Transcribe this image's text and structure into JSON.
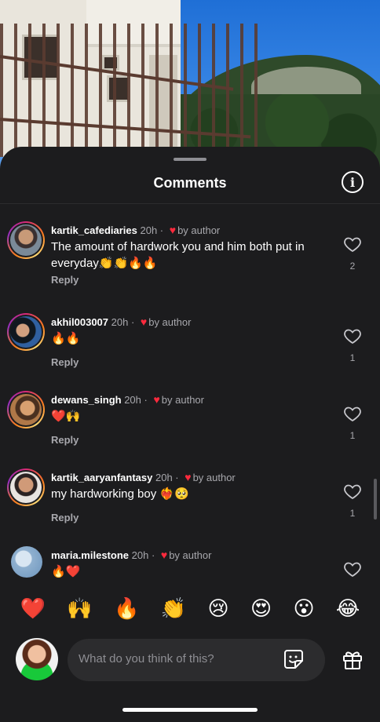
{
  "sheet": {
    "title": "Comments"
  },
  "comments": [
    {
      "username": "kartik_cafediaries",
      "time": "20h",
      "liked_by": "by author",
      "text": "The amount of hardwork you and him both put in everyday👏👏🔥🔥",
      "reply": "Reply",
      "likes": "2"
    },
    {
      "username": "akhil003007",
      "time": "20h",
      "liked_by": "by author",
      "text": "🔥🔥",
      "reply": "Reply",
      "likes": "1"
    },
    {
      "username": "dewans_singh",
      "time": "20h",
      "liked_by": "by author",
      "text": "❤️🙌",
      "reply": "Reply",
      "likes": "1"
    },
    {
      "username": "kartik_aaryanfantasy",
      "time": "20h",
      "liked_by": "by author",
      "text": "my hardworking boy ❤️‍🔥🥺",
      "reply": "Reply",
      "likes": "1"
    },
    {
      "username": "maria.milestone",
      "time": "20h",
      "liked_by": "by author",
      "text": "🔥❤️"
    }
  ],
  "quick_reactions": [
    "❤️",
    "🙌",
    "🔥",
    "👏",
    "😢",
    "😍",
    "😮",
    "😂"
  ],
  "composer": {
    "placeholder": "What do you think of this?"
  },
  "colors": {
    "background": "#1c1c1e",
    "liked_heart": "#ff2a3d",
    "muted_text": "#a8a8ad"
  }
}
